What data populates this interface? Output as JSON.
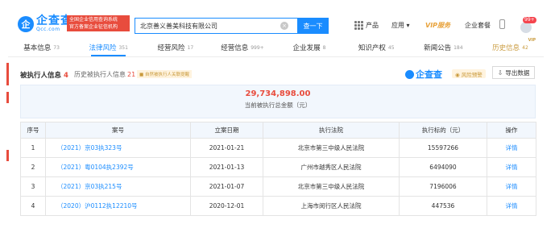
{
  "header": {
    "logo_mark": "企",
    "logo_title": "企查查",
    "logo_domain": "Qcc.com",
    "slogan_line1": "全国企业信用查询系统",
    "slogan_line2": "官方备案企业征信机构",
    "search_value": "北京善义善美科技有限公司",
    "clear_glyph": "×",
    "search_button": "查一下",
    "nav_products": "产品",
    "nav_apps": "应用 ▾",
    "nav_vip": "VIP服务",
    "nav_enterprise": "企业套餐",
    "notification_count": "99+"
  },
  "tabs": [
    {
      "label": "基本信息",
      "count": "73"
    },
    {
      "label": "法律风险",
      "count": "351"
    },
    {
      "label": "经营风险",
      "count": "17"
    },
    {
      "label": "经营信息",
      "count": "999+"
    },
    {
      "label": "企业发展",
      "count": "8"
    },
    {
      "label": "知识产权",
      "count": "45"
    },
    {
      "label": "新闻公告",
      "count": "184"
    },
    {
      "label": "历史信息",
      "count": "42",
      "vip": "VIP"
    }
  ],
  "section": {
    "title": "被执行人信息",
    "count": "4",
    "history_label": "历史被执行人信息",
    "history_count": "21",
    "ai_tag": "■ 自然被执行人关联提醒",
    "mini_logo_text": "企查查",
    "watermark_tag": "◉ 风险预警",
    "export_icon": "⇩",
    "export_label": "导出数据"
  },
  "summary": {
    "amount": "29,734,898.00",
    "label": "当前被执行总金额（元）"
  },
  "table": {
    "headers": [
      "序号",
      "案号",
      "立案日期",
      "执行法院",
      "执行标的（元）",
      "操作"
    ],
    "rows": [
      {
        "index": "1",
        "case_no": "（2021）京03执323号",
        "date": "2021-01-21",
        "court": "北京市第三中级人民法院",
        "amount": "15597266",
        "action": "详情"
      },
      {
        "index": "2",
        "case_no": "（2021）粤0104执2392号",
        "date": "2021-01-13",
        "court": "广州市越秀区人民法院",
        "amount": "6494090",
        "action": "详情"
      },
      {
        "index": "3",
        "case_no": "（2021）京03执215号",
        "date": "2021-01-07",
        "court": "北京市第三中级人民法院",
        "amount": "7196006",
        "action": "详情"
      },
      {
        "index": "4",
        "case_no": "（2020）沪0112执12210号",
        "date": "2020-12-01",
        "court": "上海市闵行区人民法院",
        "amount": "447536",
        "action": "详情"
      }
    ]
  },
  "colors": {
    "brand_blue": "#1a8cff",
    "risk_red": "#e84c3d",
    "vip_gold": "#c99a3c"
  }
}
